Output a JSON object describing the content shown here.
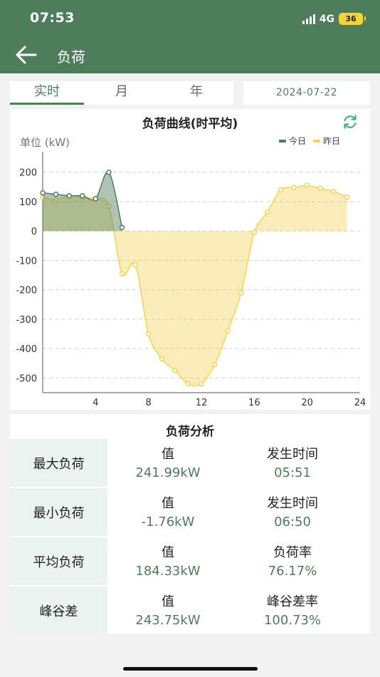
{
  "status_bar": {
    "time": "07:53",
    "network": "4G",
    "battery": "36"
  },
  "header": {
    "title": "负荷"
  },
  "tabs": [
    {
      "label": "实时",
      "active": true
    },
    {
      "label": "月",
      "active": false
    },
    {
      "label": "年",
      "active": false
    }
  ],
  "date": "2024-07-22",
  "chart_section": {
    "unit": "单位 (kW)"
  },
  "chart_data": {
    "type": "area",
    "title": "负荷曲线(时平均)",
    "ylim": [
      -550,
      260
    ],
    "xlim": [
      0,
      24
    ],
    "x_ticks": [
      4,
      8,
      12,
      16,
      20,
      24
    ],
    "y_ticks": [
      200,
      100,
      0,
      -100,
      -200,
      -300,
      -400,
      -500
    ],
    "grid": true,
    "legend_position": "top-right",
    "series": [
      {
        "name": "今日",
        "color": "#4e7d5b",
        "fill": "rgba(78,125,91,0.45)",
        "x": [
          0,
          1,
          2,
          3,
          4,
          5,
          6
        ],
        "y": [
          130,
          125,
          120,
          120,
          110,
          200,
          12
        ]
      },
      {
        "name": "昨日",
        "color": "#f5d34f",
        "fill": "rgba(245,211,79,0.40)",
        "x": [
          0,
          1,
          2,
          3,
          4,
          5,
          6,
          7,
          8,
          9,
          10,
          11,
          12,
          13,
          14,
          15,
          16,
          17,
          18,
          19,
          20,
          21,
          22,
          23
        ],
        "y": [
          115,
          105,
          120,
          115,
          110,
          85,
          -145,
          -115,
          -350,
          -435,
          -475,
          -520,
          -520,
          -455,
          -340,
          -210,
          -5,
          65,
          140,
          148,
          155,
          145,
          135,
          115
        ]
      }
    ]
  },
  "analysis": {
    "title": "负荷分析",
    "rows": [
      {
        "label": "最大负荷",
        "col1_label": "值",
        "col1_value": "241.99kW",
        "col2_label": "发生时间",
        "col2_value": "05:51"
      },
      {
        "label": "最小负荷",
        "col1_label": "值",
        "col1_value": "-1.76kW",
        "col2_label": "发生时间",
        "col2_value": "06:50"
      },
      {
        "label": "平均负荷",
        "col1_label": "值",
        "col1_value": "184.33kW",
        "col2_label": "负荷率",
        "col2_value": "76.17%"
      },
      {
        "label": "峰谷差",
        "col1_label": "值",
        "col1_value": "243.75kW",
        "col2_label": "峰谷差率",
        "col2_value": "100.73%"
      }
    ]
  }
}
